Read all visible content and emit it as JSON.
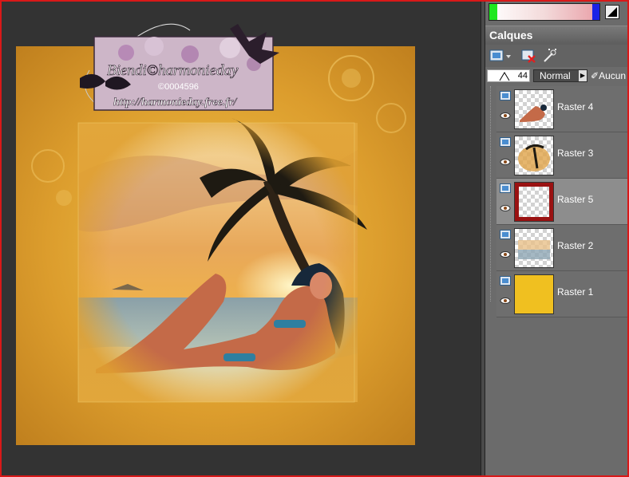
{
  "layers_panel": {
    "title": "Calques",
    "opacity_value": "44",
    "blend_mode": "Normal",
    "lock_label": "Aucun",
    "layers": [
      {
        "name": "Raster 4",
        "selected": false
      },
      {
        "name": "Raster 3",
        "selected": false
      },
      {
        "name": "Raster 5",
        "selected": true
      },
      {
        "name": "Raster 2",
        "selected": false
      },
      {
        "name": "Raster 1",
        "selected": false
      }
    ]
  },
  "watermark": {
    "name": "Biendi©harmonieday",
    "number": "©0004596",
    "url": "http://harmonieday.free.fr/"
  },
  "colors": {
    "frame_border": "#d81818",
    "workspace_bg": "#333333",
    "panel_bg": "#6b6b6b",
    "selected_layer_bg": "#8d8d8d",
    "canvas_orange": "#d89a2a",
    "raster1_yellow": "#f0c020"
  }
}
